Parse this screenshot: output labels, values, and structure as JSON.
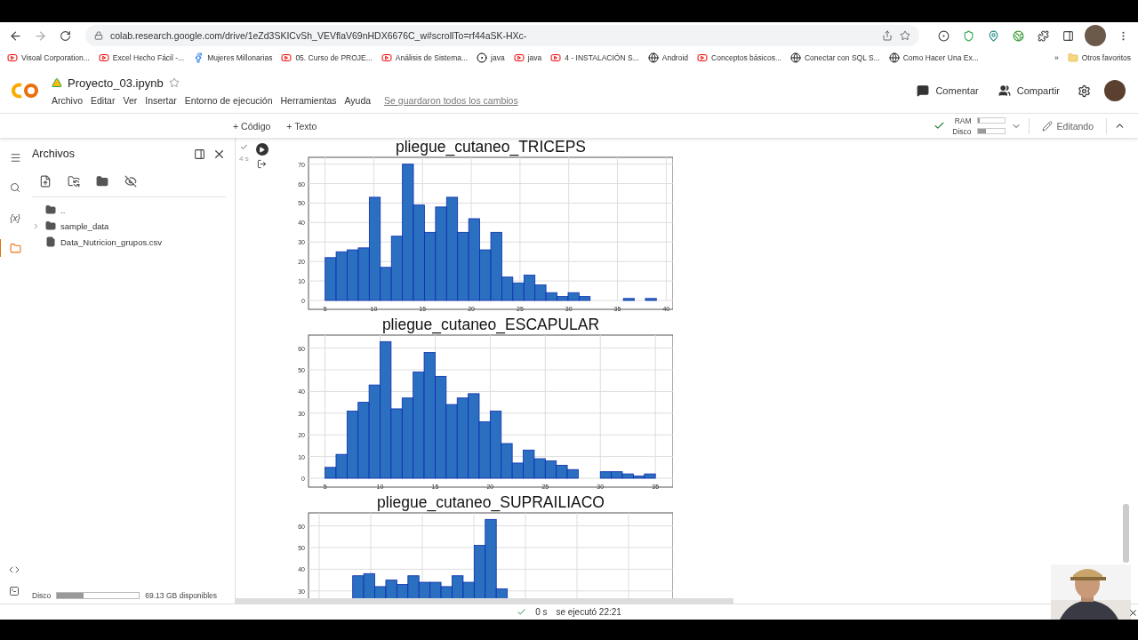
{
  "browser": {
    "url": "colab.research.google.com/drive/1eZd3SKICvSh_VEVflaV69nHDX6676C_w#scrollTo=rf44aSK-HXc-",
    "bookmarks": [
      {
        "kind": "youtube",
        "label": "Visoal Corporation..."
      },
      {
        "kind": "youtube",
        "label": "Excel Hecho Fácil -..."
      },
      {
        "kind": "facebook",
        "label": "Mujeres Millonarias"
      },
      {
        "kind": "youtube",
        "label": "05. Curso de PROJE..."
      },
      {
        "kind": "youtube",
        "label": "Análisis de Sistema..."
      },
      {
        "kind": "app",
        "label": "java"
      },
      {
        "kind": "youtube",
        "label": "java"
      },
      {
        "kind": "youtube",
        "label": "4 - INSTALACIÓN S..."
      },
      {
        "kind": "globe",
        "label": "Android"
      },
      {
        "kind": "youtube",
        "label": "Conceptos básicos..."
      },
      {
        "kind": "globe",
        "label": "Conectar con SQL S..."
      },
      {
        "kind": "globe",
        "label": "Como Hacer Una Ex..."
      }
    ],
    "more": "»",
    "other_bookmarks": "Otros favoritos"
  },
  "notebook": {
    "title": "Proyecto_03.ipynb",
    "menu": [
      "Archivo",
      "Editar",
      "Ver",
      "Insertar",
      "Entorno de ejecución",
      "Herramientas",
      "Ayuda"
    ],
    "save_status": "Se guardaron todos los cambios",
    "comment": "Comentar",
    "share": "Compartir"
  },
  "toolbar": {
    "add_buttons": [
      "+ Código",
      "+ Texto"
    ],
    "meters": [
      {
        "label": "RAM",
        "level": 0.08
      },
      {
        "label": "Disco",
        "level": 0.3
      }
    ],
    "mode": "Editando"
  },
  "rail": [
    {
      "kind": "menu",
      "selected": false
    },
    {
      "kind": "search",
      "selected": false
    },
    {
      "kind": "text",
      "label": "{x}",
      "selected": false
    },
    {
      "kind": "folder",
      "selected": true
    }
  ],
  "sidebar": {
    "title": "Archivos",
    "files": [
      {
        "kind": "parent",
        "name": ".."
      },
      {
        "kind": "folder",
        "name": "sample_data",
        "expanded": false
      },
      {
        "kind": "file",
        "name": "Data_Nutricion_grupos.csv"
      }
    ],
    "disk": {
      "label": "Disco",
      "level": 0.32,
      "free": "69.13 GB disponibles"
    }
  },
  "cell": {
    "elapsed": "4 s",
    "charts": [
      {
        "chart_data": {
          "type": "bar",
          "title": "pliegue_cutaneo_TRICEPS",
          "xlim": [
            3.3,
            40.7
          ],
          "ylim": [
            0,
            73.5
          ],
          "xticks": [
            5,
            10,
            15,
            20,
            25,
            30,
            35,
            40
          ],
          "yticks": [
            0,
            10,
            20,
            30,
            40,
            50,
            60,
            70
          ],
          "grid": true,
          "x": [
            5.57,
            6.7,
            7.83,
            8.97,
            10.1,
            11.23,
            12.37,
            13.5,
            14.63,
            15.77,
            16.9,
            18.03,
            19.17,
            20.3,
            21.43,
            22.57,
            23.7,
            24.83,
            25.97,
            27.1,
            28.23,
            29.37,
            30.5,
            31.63,
            32.77,
            33.9,
            35.03,
            36.17,
            37.3,
            38.43
          ],
          "series": [
            {
              "color": "#2b6fc0",
              "values": [
                22,
                25,
                26,
                27,
                53,
                17,
                33,
                70,
                49,
                35,
                48,
                53,
                35,
                42,
                26,
                35,
                12,
                9,
                13,
                8,
                4,
                2,
                4,
                2,
                0,
                0,
                0,
                1,
                0,
                1
              ]
            }
          ]
        }
      },
      {
        "chart_data": {
          "type": "bar",
          "title": "pliegue_cutaneo_ESCAPULAR",
          "xlim": [
            3.5,
            36.6
          ],
          "ylim": [
            0,
            66
          ],
          "xticks": [
            5,
            10,
            15,
            20,
            25,
            30,
            35
          ],
          "yticks": [
            0,
            10,
            20,
            30,
            40,
            50,
            60
          ],
          "grid": true,
          "x": [
            5.5,
            6.5,
            7.5,
            8.5,
            9.5,
            10.5,
            11.5,
            12.5,
            13.5,
            14.5,
            15.5,
            16.5,
            17.5,
            18.5,
            19.5,
            20.5,
            21.5,
            22.5,
            23.5,
            24.5,
            25.5,
            26.5,
            27.5,
            28.5,
            29.5,
            30.5,
            31.5,
            32.5,
            33.5,
            34.5
          ],
          "series": [
            {
              "color": "#2b6fc0",
              "values": [
                5,
                11,
                31,
                35,
                43,
                63,
                32,
                37,
                49,
                58,
                47,
                34,
                37,
                39,
                26,
                31,
                16,
                7,
                13,
                9,
                8,
                6,
                4,
                0,
                0,
                3,
                3,
                2,
                1,
                2
              ]
            }
          ]
        }
      },
      {
        "chart_data": {
          "type": "bar",
          "title": "pliegue_cutaneo_SUPRAILIACO",
          "ylim": [
            25,
            66
          ],
          "yticks": [
            30,
            40,
            50,
            60
          ],
          "grid": true,
          "series": [
            {
              "color": "#2b6fc0",
              "values": [
                null,
                null,
                null,
                null,
                37,
                38,
                32,
                35,
                33,
                37,
                34,
                34,
                32,
                37,
                34,
                51,
                63,
                31,
                null,
                null,
                null,
                null,
                null,
                null,
                null,
                null,
                null,
                null,
                null,
                null,
                null,
                null,
                null
              ]
            }
          ]
        }
      }
    ]
  },
  "status": {
    "duration": "0 s",
    "executed": "se ejecutó 22:21"
  }
}
